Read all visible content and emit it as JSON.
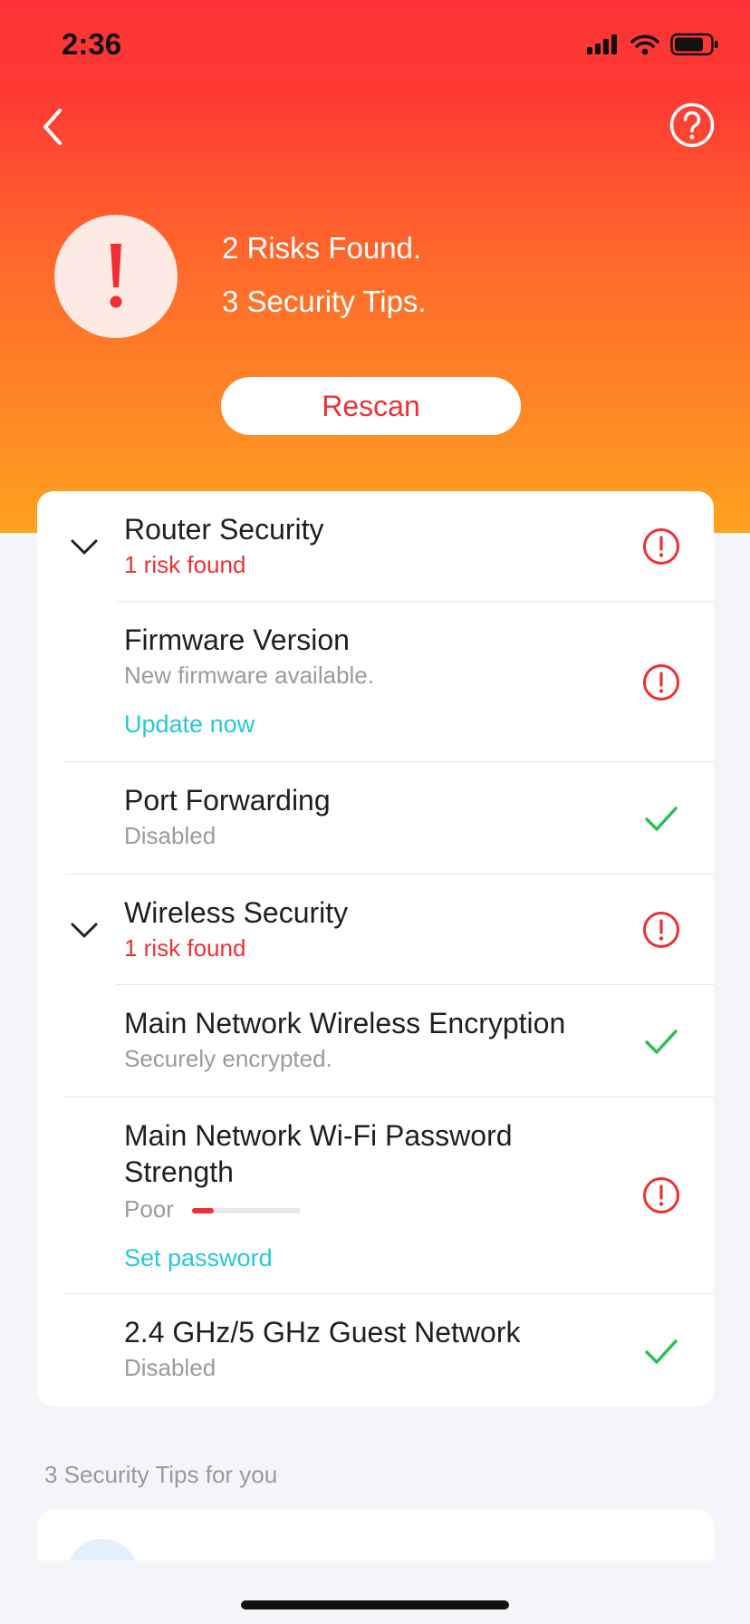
{
  "status_bar": {
    "time": "2:36"
  },
  "summary": {
    "risks_line": "2 Risks Found.",
    "tips_line": "3 Security Tips.",
    "rescan_label": "Rescan"
  },
  "sections": {
    "router": {
      "title": "Router Security",
      "subtitle": "1 risk found",
      "items": {
        "firmware": {
          "title": "Firmware Version",
          "subtitle": "New firmware available.",
          "action": "Update now"
        },
        "port_forwarding": {
          "title": "Port Forwarding",
          "subtitle": "Disabled"
        }
      }
    },
    "wireless": {
      "title": "Wireless Security",
      "subtitle": "1 risk found",
      "items": {
        "encryption": {
          "title": "Main Network Wireless Encryption",
          "subtitle": "Securely encrypted."
        },
        "password": {
          "title_line1": "Main Network Wi-Fi Password",
          "title_line2": "Strength",
          "strength_label": "Poor",
          "strength_fraction": 0.2,
          "action": "Set password"
        },
        "guest": {
          "title": "2.4 GHz/5 GHz Guest Network",
          "subtitle": "Disabled"
        }
      }
    }
  },
  "tips": {
    "heading": "3 Security Tips for you"
  },
  "icons": {
    "risk": "exclamation-circle-icon",
    "ok": "checkmark-icon",
    "back": "chevron-left-icon",
    "help": "question-circle-icon",
    "expand": "chevron-down-icon"
  },
  "colors": {
    "risk": "#ef2f34",
    "ok": "#2bbf55",
    "link": "#27c7dc",
    "hero_top": "#fe3236",
    "hero_bottom": "#ffa21f"
  }
}
